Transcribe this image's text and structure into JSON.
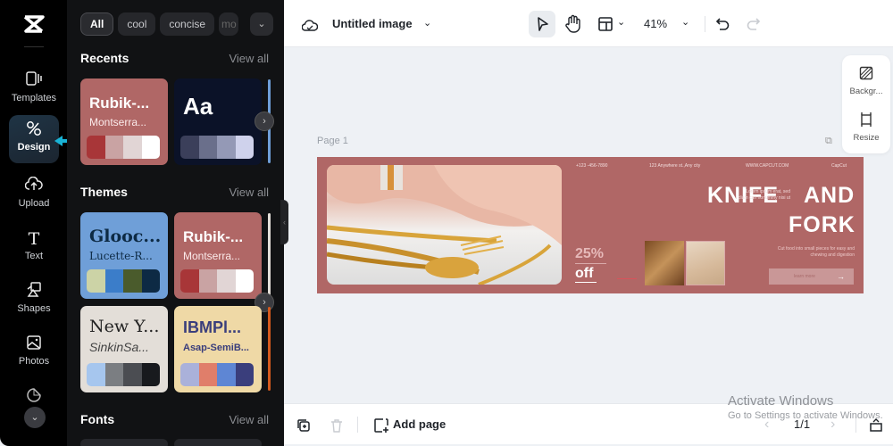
{
  "rail": {
    "logo_icon": "capcut-logo",
    "items": [
      {
        "label": "Templates",
        "icon": "▯|",
        "active": false
      },
      {
        "label": "Design",
        "icon": "✎",
        "active": true
      },
      {
        "label": "Upload",
        "icon": "☁",
        "active": false
      },
      {
        "label": "Text",
        "icon": "T",
        "active": false
      },
      {
        "label": "Shapes",
        "icon": "◇",
        "active": false
      },
      {
        "label": "Photos",
        "icon": "▣",
        "active": false
      },
      {
        "label": "Stickers",
        "icon": "◔",
        "active": false
      }
    ],
    "more_icon": "⌄"
  },
  "panel": {
    "chips": [
      "All",
      "cool",
      "concise",
      "mo"
    ],
    "chip_more_icon": "⌄",
    "recents": {
      "title": "Recents",
      "view_all": "View all",
      "cards": [
        {
          "title": "Rubik-...",
          "subtitle": "Montserra...",
          "bg": "#b06766",
          "swatches": [
            "#a83638",
            "#c9a3a3",
            "#e1d5d5",
            "#ffffff"
          ]
        },
        {
          "title": "Aa",
          "subtitle": "",
          "bg": "#0b1228",
          "swatches": [
            "#3b3f5a",
            "#6a6f8b",
            "#9499b6",
            "#cfd2ec"
          ]
        }
      ]
    },
    "themes": {
      "title": "Themes",
      "view_all": "View all",
      "cards": [
        {
          "title": "Glooc...",
          "subtitle": "Lucette-R...",
          "bg": "#6f9fd8",
          "swatches": [
            "#ccd3a6",
            "#3b7dc9",
            "#4a5b2c",
            "#0d2a44"
          ]
        },
        {
          "title": "Rubik-...",
          "subtitle": "Montserra...",
          "bg": "#b06766",
          "swatches": [
            "#a83638",
            "#c9a3a3",
            "#e1d5d5",
            "#ffffff"
          ]
        },
        {
          "title": "New Y...",
          "subtitle": "SinkinSa...",
          "bg": "#e3ded8",
          "swatches": [
            "#a6c6ee",
            "#7b7e82",
            "#4b4d52",
            "#181a1e"
          ]
        },
        {
          "title": "IBMPl...",
          "subtitle": "Asap-SemiB...",
          "bg": "#efd9a6",
          "swatches": [
            "#aab1da",
            "#e07e6a",
            "#5e86d4",
            "#3a3e7c"
          ]
        }
      ]
    },
    "fonts": {
      "title": "Fonts",
      "view_all": "View all"
    }
  },
  "topbar": {
    "cloud_icon": "cloud",
    "doc_title": "Untitled image",
    "zoom": "41%"
  },
  "side_tools": [
    {
      "label": "Backgr...",
      "icon": "▨"
    },
    {
      "label": "Resize",
      "icon": "⧉"
    }
  ],
  "page": {
    "label": "Page 1",
    "design": {
      "phone": "+123 -456-7890",
      "address": "123 Anywhere st.,Any city",
      "website": "WWW.CAPCUT.COM",
      "brand": "CapCut",
      "headline1": "KNIFE",
      "headline2": "AND",
      "headline3": "FORK",
      "overlap_copy": "Lorem ipsum erat, sed diam can nonummy nisi ut",
      "copy": "Cut food into small pieces for easy and chewing and digestion",
      "discount": "25%",
      "discount_word": "off",
      "cta": "learn more",
      "bg": "#b06766"
    }
  },
  "bottombar": {
    "add_page": "Add page",
    "pagination": "1/1"
  },
  "watermark": {
    "line1": "Activate Windows",
    "line2": "Go to Settings to activate Windows."
  }
}
